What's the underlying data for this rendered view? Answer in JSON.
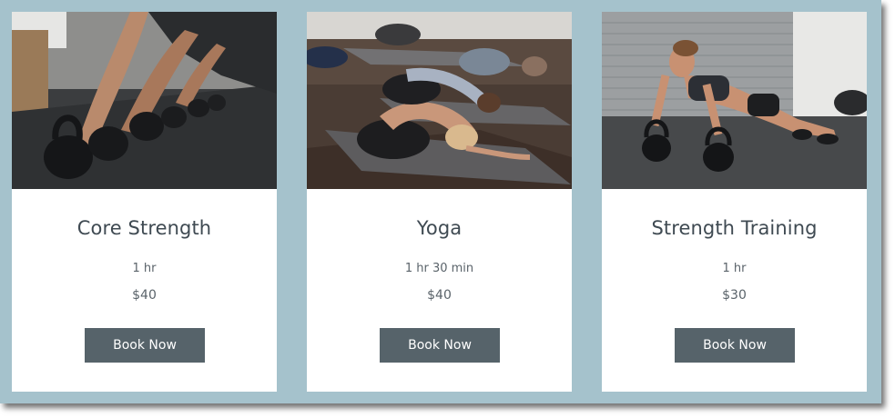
{
  "services": [
    {
      "image": "kettlebell-class-photo",
      "title": "Core Strength",
      "duration": "1 hr",
      "price": "$40",
      "button_label": "Book Now"
    },
    {
      "image": "yoga-class-photo",
      "title": "Yoga",
      "duration": "1 hr 30 min",
      "price": "$40",
      "button_label": "Book Now"
    },
    {
      "image": "kettlebell-pushup-photo",
      "title": "Strength Training",
      "duration": "1 hr",
      "price": "$30",
      "button_label": "Book Now"
    }
  ],
  "colors": {
    "frame_background": "#a5c2cc",
    "card_background": "#ffffff",
    "button_background": "#56636a",
    "button_text": "#ffffff",
    "title_text": "#3f4a52",
    "meta_text": "#5a636a"
  }
}
